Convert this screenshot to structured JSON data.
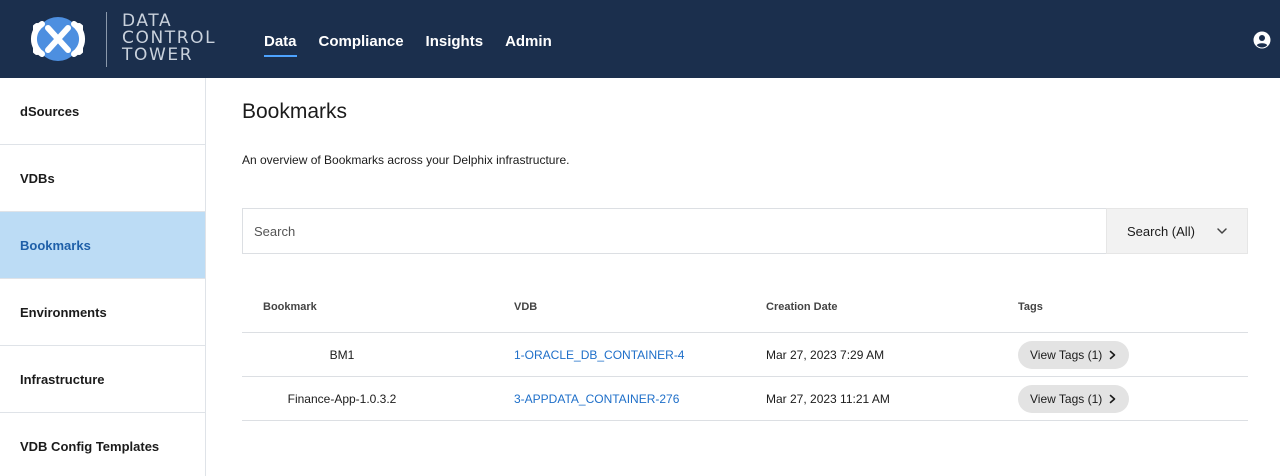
{
  "brand": {
    "logo_name": "delphix-logo-icon",
    "title_lines": [
      "DATA",
      "CONTROL",
      "TOWER"
    ]
  },
  "nav": {
    "items": [
      {
        "label": "Data",
        "active": true
      },
      {
        "label": "Compliance"
      },
      {
        "label": "Insights"
      },
      {
        "label": "Admin"
      }
    ],
    "user_icon": "user-circle-icon"
  },
  "sidebar": {
    "items": [
      {
        "label": "dSources"
      },
      {
        "label": "VDBs"
      },
      {
        "label": "Bookmarks",
        "active": true
      },
      {
        "label": "Environments"
      },
      {
        "label": "Infrastructure"
      },
      {
        "label": "VDB Config Templates"
      }
    ]
  },
  "page": {
    "title": "Bookmarks",
    "description": "An overview of Bookmarks across your Delphix infrastructure."
  },
  "search": {
    "placeholder": "Search",
    "value": "",
    "scope_label": "Search (All)"
  },
  "table": {
    "columns": [
      "Bookmark",
      "VDB",
      "Creation Date",
      "Tags"
    ],
    "rows": [
      {
        "bookmark": "BM1",
        "vdb": "1-ORACLE_DB_CONTAINER-4",
        "created": "Mar 27, 2023 7:29 AM",
        "tags": "View Tags (1)"
      },
      {
        "bookmark": "Finance-App-1.0.3.2",
        "vdb": "3-APPDATA_CONTAINER-276",
        "created": "Mar 27, 2023 11:21 AM",
        "tags": "View Tags (1)"
      }
    ]
  },
  "colors": {
    "topbar": "#1b2f4d",
    "sidebar_active_bg": "#bcdcf5",
    "link": "#1e6fc9",
    "nav_underline": "#4da3ff"
  }
}
